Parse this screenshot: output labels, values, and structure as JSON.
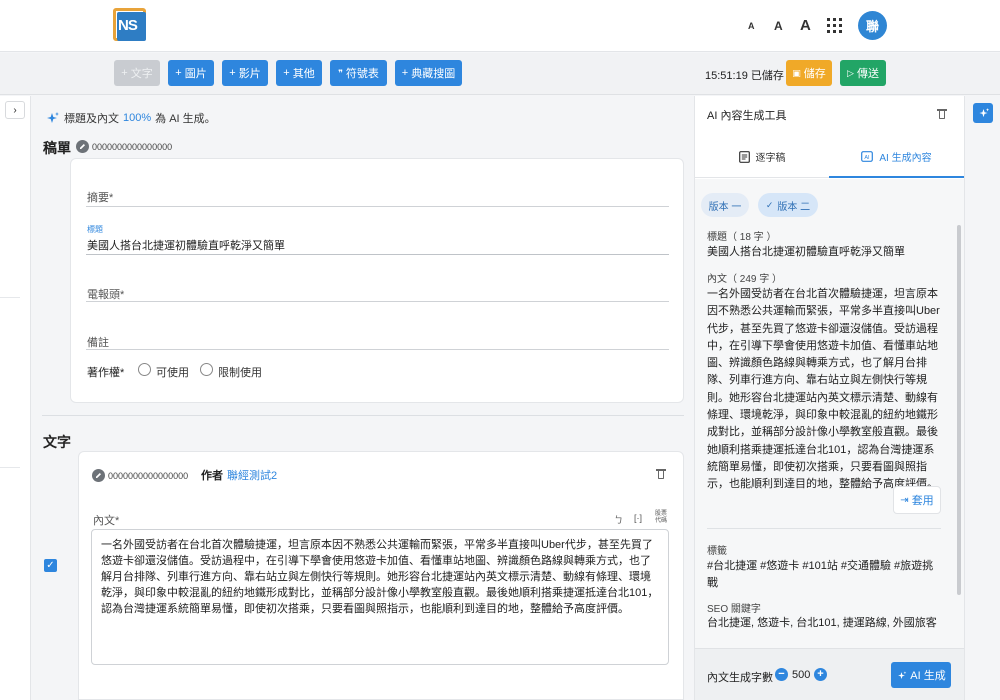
{
  "header": {
    "logo_text": "NS",
    "font_small": "A",
    "font_medium": "A",
    "font_large": "A",
    "avatar_text": "聯"
  },
  "toolbar": {
    "text_btn": "文字",
    "image_btn": "圖片",
    "video_btn": "影片",
    "other_btn": "其他",
    "symbol_btn": "符號表",
    "archive_btn": "典藏搜圖",
    "saved_status": "15:51:19 已儲存",
    "save_btn": "儲存",
    "send_btn": "傳送"
  },
  "ai_note": {
    "prefix": "標題及內文",
    "percent": "100%",
    "suffix": "為 AI 生成。"
  },
  "draft": {
    "title": "稿單",
    "id": "0000000000000000",
    "summary_label": "摘要*",
    "title_mini_label": "標題",
    "title_value": "美國人搭台北捷運初體驗直呼乾淨又簡單",
    "telegram_label": "電報頭*",
    "notes_label": "備註",
    "copyright_label": "著作權*",
    "copyright_opt1": "可使用",
    "copyright_opt2": "限制使用"
  },
  "text_section": {
    "title": "文字",
    "id": "0000000000000000",
    "author_label": "作者",
    "author_name": "聯經測試2",
    "body_label": "內文*",
    "tool1": "ㄅ",
    "tool2": "[·]",
    "tool3": "股票代碼",
    "body_text": "一名外國受訪者在台北首次體驗捷運，坦言原本因不熟悉公共運輸而緊張，平常多半直接叫Uber代步，甚至先買了悠遊卡卻還沒儲值。受訪過程中，在引導下學會使用悠遊卡加值、看懂車站地圖、辨識顏色路線與轉乘方式，也了解月台排隊、列車行進方向、靠右站立與左側快行等規則。她形容台北捷運站內英文標示清楚、動線有條理、環境乾淨，與印象中較混亂的紐約地鐵形成對比，並稱部分設計像小學教室般直觀。最後她順利搭乘捷運抵達台北101，認為台灣捷運系統簡單易懂，即使初次搭乘，只要看圖與照指示，也能順利到達目的地，整體給予高度評價。"
  },
  "panel": {
    "title": "AI 內容生成工具",
    "tab_transcript": "逐字稿",
    "tab_ai": "AI 生成內容",
    "version1": "版本 一",
    "version2": "版本 二",
    "title_label": "標題（ 18 字 ）",
    "title_value": "美國人搭台北捷運初體驗直呼乾淨又簡單",
    "body_label": "內文（ 249 字 ）",
    "body_text": "一名外國受訪者在台北首次體驗捷運，坦言原本因不熟悉公共運輸而緊張，平常多半直接叫Uber代步，甚至先買了悠遊卡卻還沒儲值。受訪過程中，在引導下學會使用悠遊卡加值、看懂車站地圖、辨識顏色路線與轉乘方式，也了解月台排隊、列車行進方向、靠右站立與左側快行等規則。她形容台北捷運站內英文標示清楚、動線有條理、環境乾淨，與印象中較混亂的紐約地鐵形成對比，並稱部分設計像小學教室般直觀。最後她順利搭乘捷運抵達台北101，認為台灣捷運系統簡單易懂，即使初次搭乘，只要看圖與照指示，也能順利到達目的地，整體給予高度評價。",
    "apply_btn": "套用",
    "tags_label": "標籤",
    "tags_value": "#台北捷運 #悠遊卡 #101站 #交通體驗 #旅遊挑戰",
    "seo_label": "SEO 關鍵字",
    "seo_value": "台北捷運, 悠遊卡, 台北101, 捷運路線, 外國旅客",
    "length_label": "內文生成字數",
    "length_value": "500",
    "generate_btn": "AI 生成"
  },
  "colors": {
    "primary": "#2e86de",
    "save": "#f0a928",
    "send": "#22a566"
  }
}
